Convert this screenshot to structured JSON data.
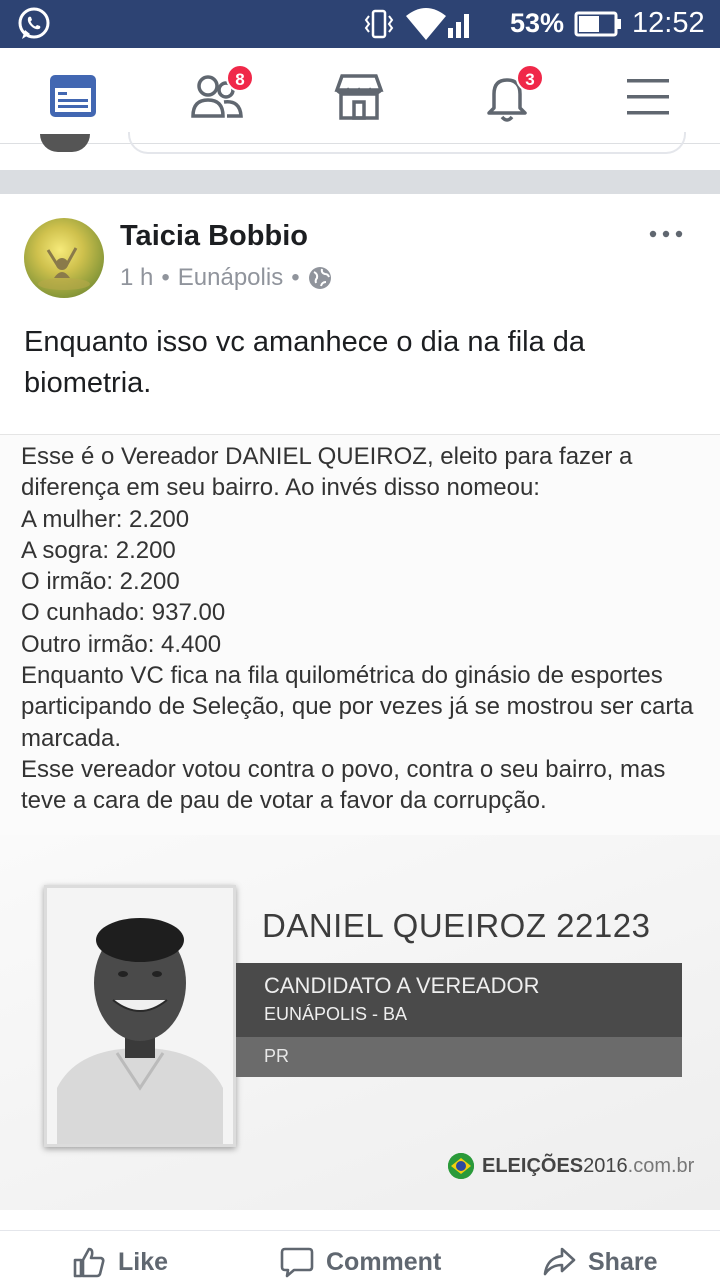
{
  "status_bar": {
    "battery_percent": "53%",
    "time": "12:52",
    "icons": [
      "whatsapp-icon",
      "vibrate-icon",
      "wifi-icon",
      "signal-icon",
      "battery-icon"
    ]
  },
  "nav": {
    "items": [
      {
        "name": "news-feed",
        "icon": "news-feed-icon",
        "active": true
      },
      {
        "name": "friend-requests",
        "icon": "friends-icon",
        "badge": "8"
      },
      {
        "name": "marketplace",
        "icon": "marketplace-icon"
      },
      {
        "name": "notifications",
        "icon": "bell-icon",
        "badge": "3"
      },
      {
        "name": "menu",
        "icon": "hamburger-icon"
      }
    ],
    "accent": "#4267b2"
  },
  "post": {
    "author": "Taicia Bobbio",
    "time": "1 h",
    "location": "Eunápolis",
    "separator": "•",
    "text": "Enquanto isso vc amanhece o dia na fila da biometria.",
    "image": {
      "caption": "Esse é o Vereador DANIEL QUEIROZ, eleito para fazer a diferença em seu bairro. Ao invés disso nomeou:\nA mulher: 2.200\nA sogra: 2.200\nO irmão: 2.200\nO cunhado: 937.00\nOutro irmão: 4.400\nEnquanto VC fica na fila quilométrica do ginásio de esportes participando de Seleção, que por vezes já se mostrou ser carta marcada.\nEsse vereador votou contra o povo, contra o seu bairro, mas teve a cara de pau de votar a favor da corrupção.",
      "candidate": {
        "name_number": "DANIEL QUEIROZ 22123",
        "role": "CANDIDATO A VEREADOR",
        "city": "EUNÁPOLIS - BA",
        "party": "PR"
      },
      "brand": {
        "bold": "ELEIÇÕES",
        "year": "2016",
        "domain": ".com.br"
      }
    }
  },
  "actions": {
    "like": "Like",
    "comment": "Comment",
    "share": "Share"
  }
}
